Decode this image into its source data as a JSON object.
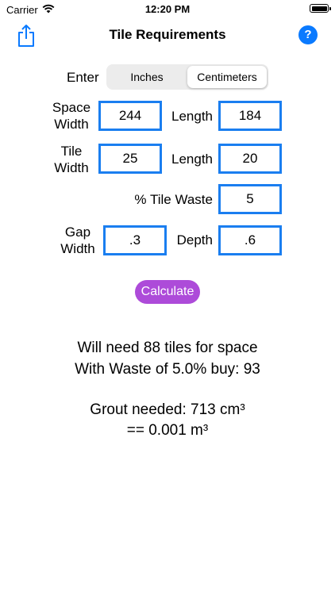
{
  "status_bar": {
    "carrier": "Carrier",
    "time": "12:20 PM"
  },
  "nav": {
    "title": "Tile Requirements",
    "help_label": "?"
  },
  "units": {
    "label": "Enter",
    "options": [
      "Inches",
      "Centimeters"
    ],
    "selected": "Centimeters"
  },
  "space": {
    "width_label_1": "Space",
    "width_label_2": "Width",
    "width_value": "244",
    "length_label": "Length",
    "length_value": "184"
  },
  "tile": {
    "width_label_1": "Tile",
    "width_label_2": "Width",
    "width_value": "25",
    "length_label": "Length",
    "length_value": "20"
  },
  "waste": {
    "label": "% Tile Waste",
    "value": "5"
  },
  "gap": {
    "width_label_1": "Gap",
    "width_label_2": "Width",
    "width_value": ".3",
    "depth_label": "Depth",
    "depth_value": ".6"
  },
  "calculate_label": "Calculate",
  "results": {
    "tiles_line": "Will need 88 tiles for space",
    "waste_line": "With Waste of 5.0% buy: 93",
    "grout_line": "Grout needed: 713 cm³",
    "grout_m3_line": "== 0.001 m³"
  },
  "colors": {
    "accent": "#1a7ef0",
    "help": "#0a7aff",
    "calculate": "#ad4bd9"
  }
}
